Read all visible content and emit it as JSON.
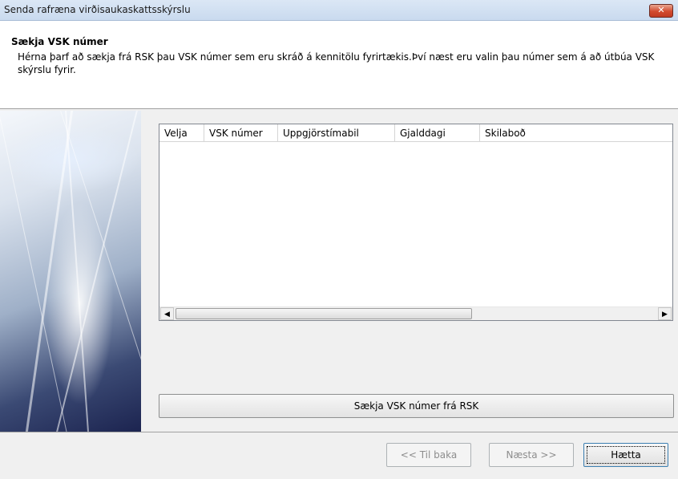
{
  "window": {
    "title": "Senda rafræna virðisaukaskattsskýrslu",
    "close_glyph": "✕"
  },
  "header": {
    "title": "Sækja VSK númer",
    "description": "Hérna þarf að sækja frá RSK þau VSK númer sem eru skráð á kennitölu fyrirtækis.Því næst eru valin þau númer sem á að útbúa VSK skýrslu fyrir."
  },
  "table": {
    "columns": [
      "Velja",
      "VSK númer",
      "Uppgjörstímabil",
      "Gjalddagi",
      "Skilaboð"
    ],
    "rows": [],
    "scroll_left_glyph": "◀",
    "scroll_right_glyph": "▶"
  },
  "actions": {
    "fetch_label": "Sækja VSK númer frá RSK"
  },
  "footer": {
    "back_label": "<< Til baka",
    "next_label": "Næsta >>",
    "cancel_label": "Hætta"
  },
  "colors": {
    "titlebar": "#c9daef",
    "close": "#d24b2f",
    "default_border": "#3c7fb1"
  }
}
